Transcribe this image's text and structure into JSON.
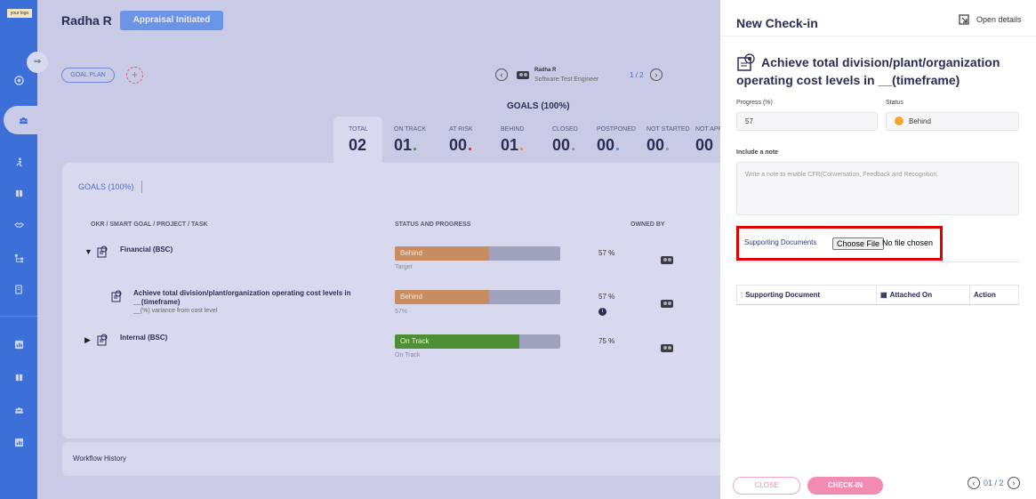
{
  "sidebar": {
    "logo": "your logo"
  },
  "header": {
    "user_name": "Radha R",
    "appraisal_status": "Appraisal Initiated",
    "goal_plan": "GOAL PLAN",
    "add_symbol": "+"
  },
  "employee": {
    "name": "Radha R",
    "role": "Software Test Engineer",
    "page": "1 / 2"
  },
  "goals_summary": {
    "heading": "GOALS (100%)",
    "stats": [
      {
        "label": "TOTAL",
        "value": "02",
        "dot": ""
      },
      {
        "label": "ON TRACK",
        "value": "01",
        "dot": "#2e9b4c"
      },
      {
        "label": "AT RISK",
        "value": "00",
        "dot": "#d8232f"
      },
      {
        "label": "BEHIND",
        "value": "01",
        "dot": "#e6942a"
      },
      {
        "label": "CLOSED",
        "value": "00",
        "dot": "#8c8fa8"
      },
      {
        "label": "POSTPONED",
        "value": "00",
        "dot": "#5d83d9"
      },
      {
        "label": "NOT STARTED",
        "value": "00",
        "dot": "#8c8fa8"
      },
      {
        "label": "NOT APP",
        "value": "00",
        "dot": ""
      }
    ]
  },
  "goals_table": {
    "tab": "GOALS (100%)",
    "columns": {
      "goal": "OKR / SMART GOAL / PROJECT / TASK",
      "status": "STATUS AND PROGRESS",
      "owner": "OWNED BY"
    },
    "rows": [
      {
        "title": "Financial (BSC)",
        "subtitle": "",
        "status": "Behind",
        "bar_sub": "Target",
        "progress": 57,
        "pct": "57 %",
        "color": "#c98c5e"
      },
      {
        "title": "Achieve total division/plant/organization operating cost levels in __(timeframe)",
        "subtitle": "__(%) variance from cost level",
        "status": "Behind",
        "bar_sub": "57%",
        "progress": 57,
        "pct": "57 %",
        "color": "#c98c5e"
      },
      {
        "title": "Internal (BSC)",
        "subtitle": "",
        "status": "On Track",
        "bar_sub": "On Track",
        "progress": 75,
        "pct": "75 %",
        "color": "#4e8f33"
      }
    ],
    "info_symbol": "i"
  },
  "workflow": {
    "label": "Workflow History"
  },
  "panel": {
    "title": "New Check-in",
    "open_details": "Open details",
    "goal_title": "Achieve total division/plant/organization operating cost levels in __(timeframe)",
    "progress_label": "Progress (%)",
    "progress_value": "57",
    "status_label": "Status",
    "status_value": "Behind",
    "note_label": "Include a note",
    "note_placeholder": "Write a note to enable CFR(Conversation, Feedback and Recognition.",
    "supporting_label": "Supporting Documents",
    "choose_file": "Choose File",
    "no_file": "No file chosen",
    "doc_columns": {
      "document": "Supporting Document",
      "attached": "Attached On",
      "action": "Action"
    },
    "close": "CLOSE",
    "checkin": "CHECK-IN",
    "page": "01 / 2"
  },
  "nav_symbols": {
    "arrow_left": "‹",
    "arrow_right": "›",
    "caret_down": "▼",
    "caret_right": "▶",
    "toggle": "⇒",
    "separator": "¦",
    "calendar": "▦"
  }
}
